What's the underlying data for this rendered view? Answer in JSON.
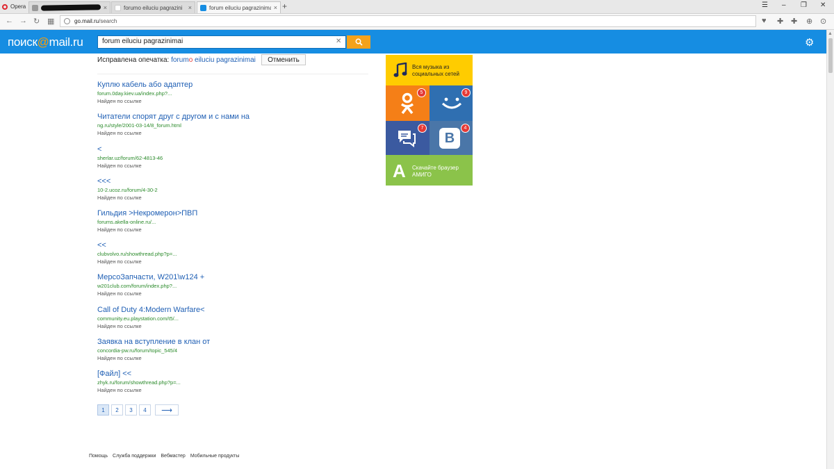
{
  "browser": {
    "menu_label": "Opera",
    "tabs": [
      {
        "title": ""
      },
      {
        "title": "forumo eiluciu pagrazini"
      },
      {
        "title": "forum eiluciu pagrazinimai"
      }
    ],
    "new_tab": "+",
    "address": {
      "host": "go.mail.ru",
      "path": "/search"
    }
  },
  "header": {
    "logo_text": "поиск",
    "logo_at": "@",
    "logo_domain": "mail.ru",
    "search_value": "forum eiluciu pagrazinimai"
  },
  "correction": {
    "label": "Исправлена опечатка:",
    "query_start": "forum",
    "query_fix": "o",
    "query_end": " eiluciu pagrazinimai",
    "cancel_label": "Отменить"
  },
  "results": [
    {
      "title": "Куплю кабель або адаптер",
      "url": "forum.0day.kiev.ua/index.php?...",
      "status": "Найден по ссылке"
    },
    {
      "title": "Читатели спорят друг с другом и с нами на",
      "url": "ng.ru/style/2001-03-14/8_forum.html",
      "status": "Найден по ссылке"
    },
    {
      "title": "<",
      "url": "sherlar.uz/forum/62-4813-46",
      "status": "Найден по ссылке"
    },
    {
      "title": "<<<",
      "url": "10-2.ucoz.ru/forum/4-30-2",
      "status": "Найден по ссылке"
    },
    {
      "title": "Гильдия >Некромерон>ПВП",
      "url": "forums.akella-online.ru/...",
      "status": "Найден по ссылке"
    },
    {
      "title": "<<",
      "url": "clubvolvo.ru/showthread.php?p=...",
      "status": "Найден по ссылке"
    },
    {
      "title": "МерсоЗапчасти, W201\\w124 +",
      "url": "w201club.com/forum/index.php?...",
      "status": "Найден по ссылке"
    },
    {
      "title": "Call of Duty 4:Modern Warfare<",
      "url": "community.eu.playstation.com/t5/...",
      "status": "Найден по ссылке"
    },
    {
      "title": "Заявка на вступление в клан от",
      "url": "concordia-pw.ru/forum/topic_545/4",
      "status": "Найден по ссылке"
    },
    {
      "title": "[Файл] <<",
      "url": "zhyk.ru/forum/showthread.php?p=...",
      "status": "Найден по ссылке"
    }
  ],
  "pagination": {
    "pages": [
      "1",
      "2",
      "3",
      "4"
    ],
    "next": "⟶",
    "current": "1"
  },
  "ad": {
    "music_text": "Вся музыка из социальных сетей",
    "ok_badge": "5",
    "smile_badge": "9",
    "msg_badge": "7",
    "vk_badge": "4",
    "vk_letter": "В",
    "amigo_letter": "А",
    "amigo_text": "Скачайте браузер АМИГО"
  },
  "footer": [
    "Помощь",
    "Служба поддержки",
    "Вебмастер",
    "Мобильные продукты"
  ],
  "colors": {
    "header_blue": "#168de2",
    "search_orange": "#f4a21b",
    "link_blue": "#1f5fb4",
    "url_green": "#2a8a2a"
  }
}
